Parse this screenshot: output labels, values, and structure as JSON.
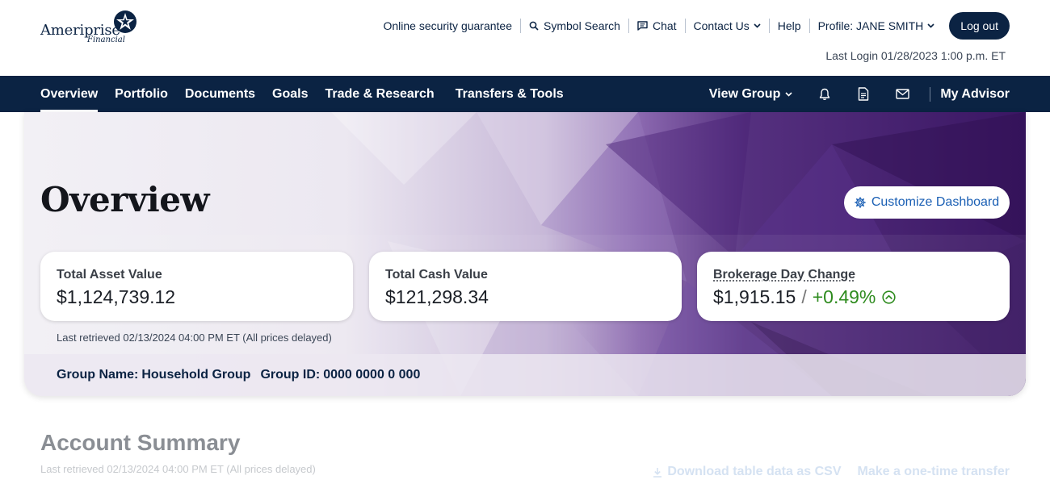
{
  "brand": {
    "logo_text": "Ameriprise",
    "logo_sub": "Financial"
  },
  "utility_nav": {
    "security": "Online security guarantee",
    "symbol_search": "Symbol Search",
    "chat": "Chat",
    "contact_us": "Contact Us",
    "help": "Help",
    "profile": "Profile: JANE SMITH",
    "logout": "Log out",
    "last_login": "Last Login 01/28/2023 1:00 p.m. ET"
  },
  "main_nav": {
    "items": [
      "Overview",
      "Portfolio",
      "Documents",
      "Goals",
      "Trade & Research",
      "Transfers & Tools"
    ],
    "active": "Overview",
    "view_group": "View Group",
    "my_advisor": "My Advisor"
  },
  "hero": {
    "title": "Overview",
    "customize": "Customize Dashboard",
    "cards": [
      {
        "label": "Total Asset Value",
        "value": "$1,124,739.12"
      },
      {
        "label": "Total Cash Value",
        "value": "$121,298.34"
      },
      {
        "label": "Brokerage Day Change",
        "value": "$1,915.15",
        "separator": "/",
        "change": "+0.49%"
      }
    ],
    "retrieved": "Last retrieved 02/13/2024 04:00 PM ET (All prices delayed)",
    "group_name_label": "Group Name:",
    "group_name": "Household Group",
    "group_id_label": "Group ID:",
    "group_id": "0000 0000 0 000"
  },
  "account_summary": {
    "title": "Account Summary",
    "retrieved": "Last retrieved 02/13/2024 04:00 PM ET (All prices delayed)",
    "download": "Download table data as CSV",
    "transfer": "Make a one-time transfer"
  },
  "colors": {
    "navy": "#0b2343",
    "link_blue": "#1a5fb4",
    "positive_green": "#2e8b1e",
    "hero_purple": "#3d1a66"
  },
  "icons": {
    "symbol_search": "search-icon",
    "chat": "chat-icon",
    "notifications": "bell-icon",
    "documents": "document-icon",
    "messages": "mail-icon",
    "customize": "gear-icon",
    "day_change": "arrow-up-circle-icon",
    "download": "download-icon"
  }
}
